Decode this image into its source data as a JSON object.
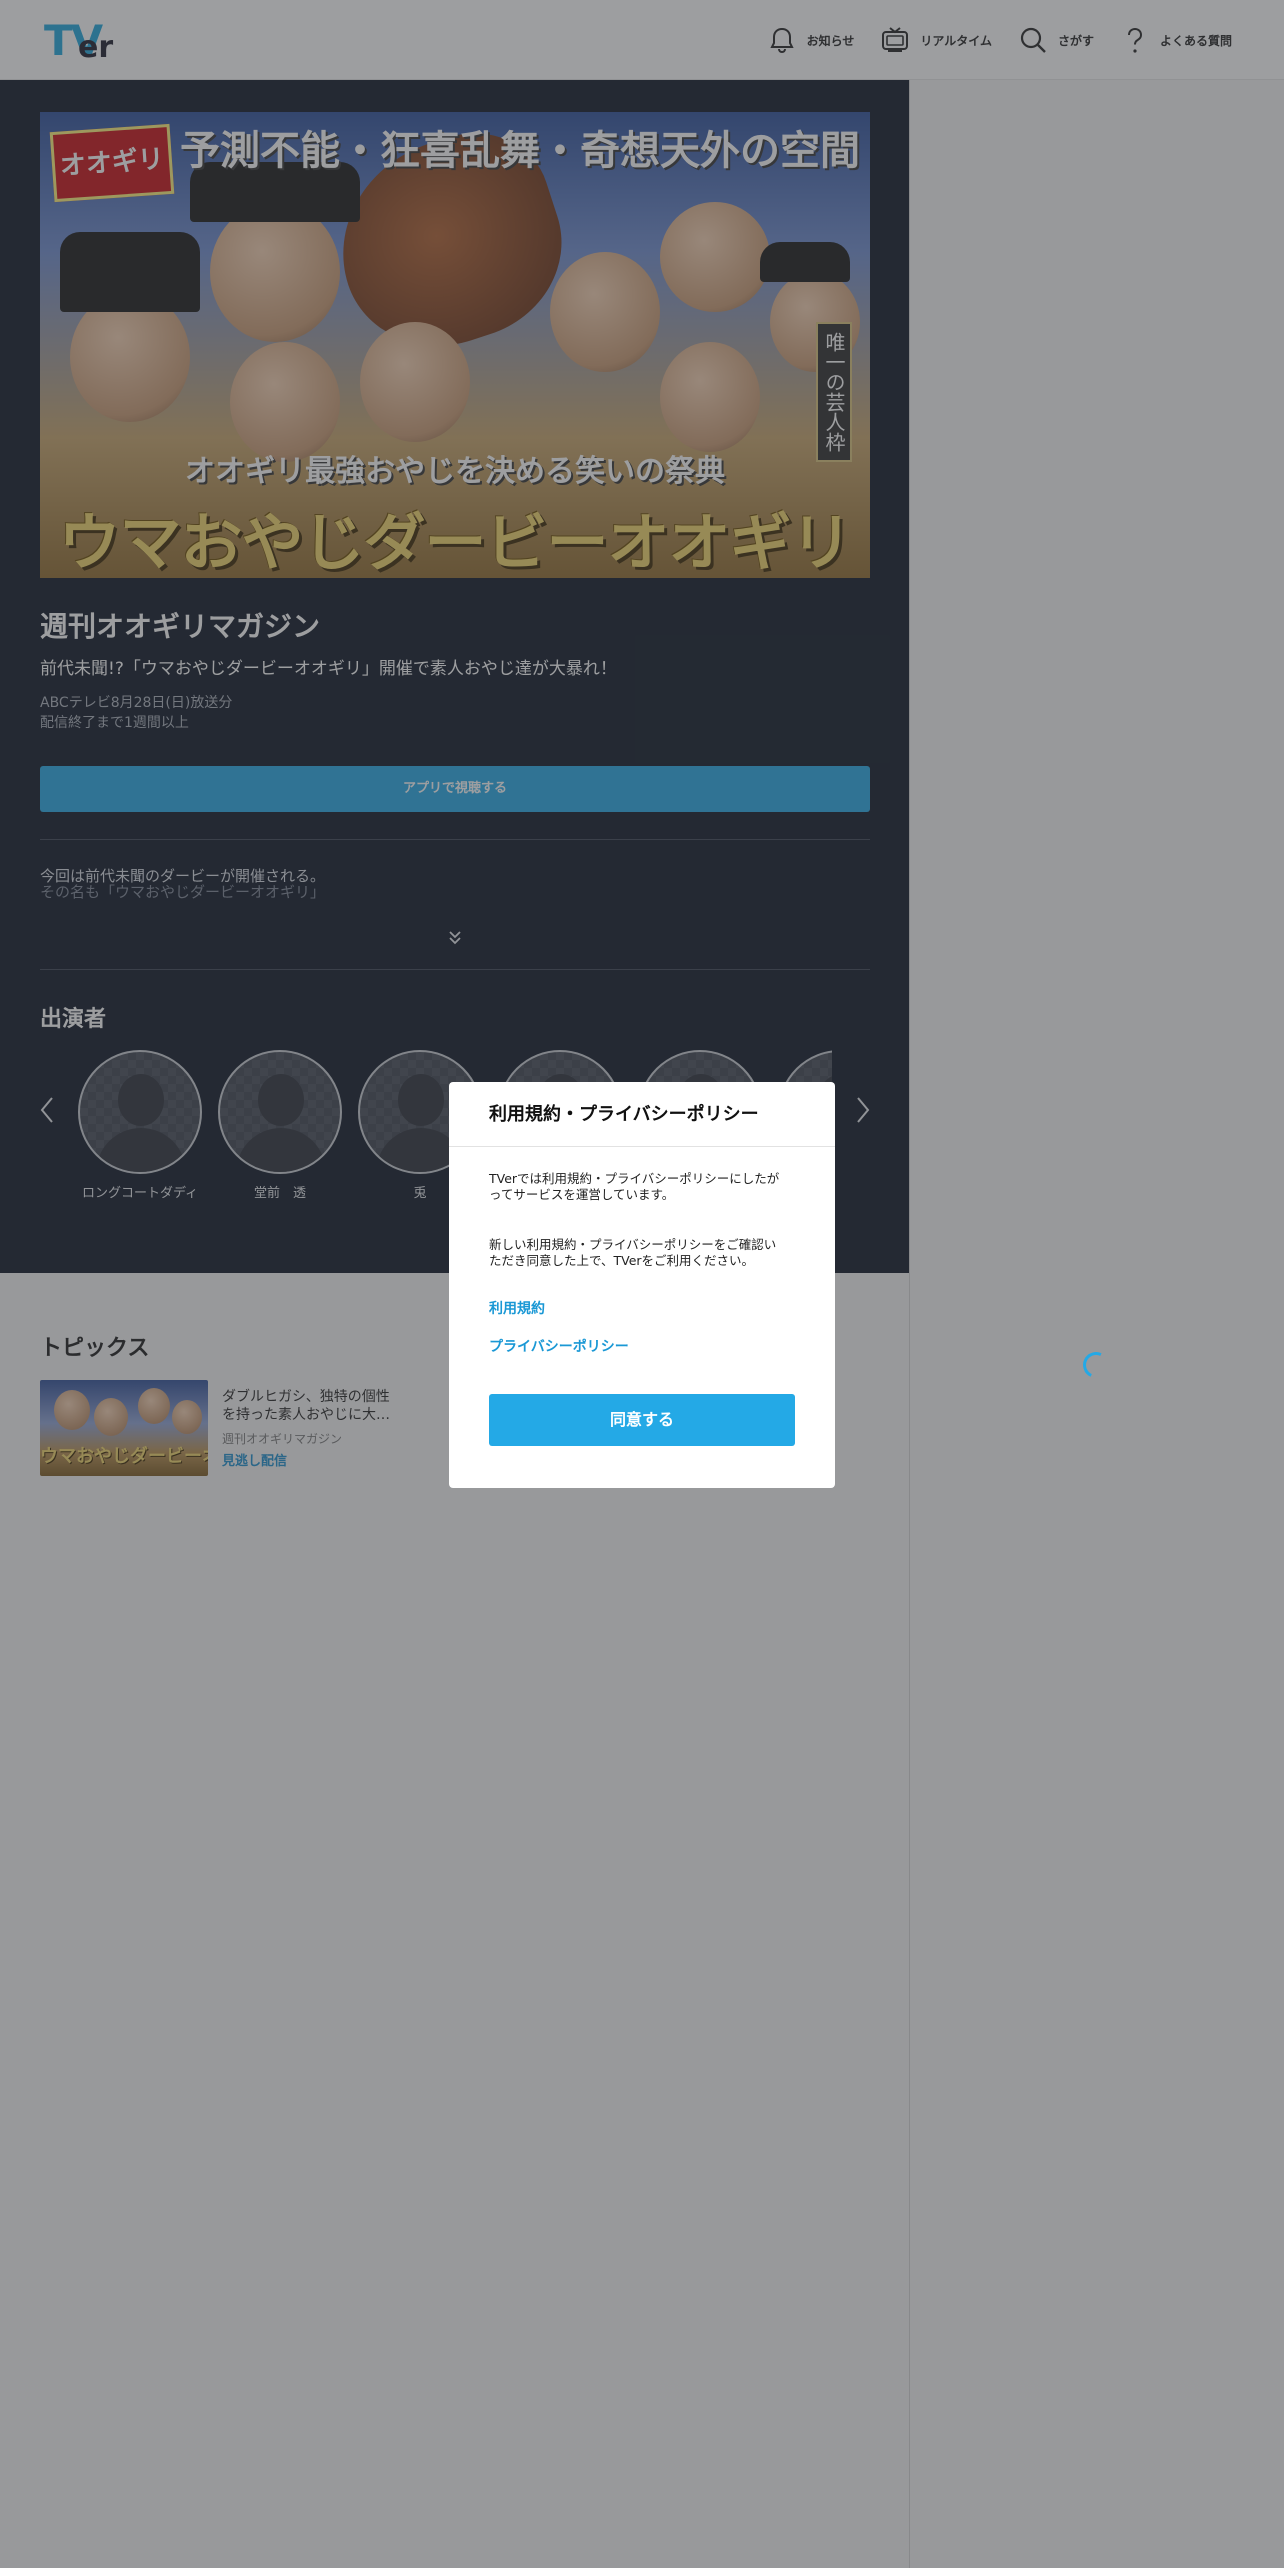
{
  "header": {
    "logo_main": "TV",
    "logo_sub": "er",
    "nav": [
      {
        "label": "お知らせ",
        "icon": "bell-icon"
      },
      {
        "label": "リアルタイム",
        "icon": "tv-icon"
      },
      {
        "label": "さがす",
        "icon": "search-icon"
      },
      {
        "label": "よくある質問",
        "icon": "question-icon"
      }
    ]
  },
  "hero": {
    "magazine_logo": "オオギリ",
    "top_caption": "予測不能・狂喜乱舞・奇想天外の空間",
    "vertical_caption": "唯一の芸人枠",
    "sub_caption": "オオギリ最強おやじを決める笑いの祭典",
    "big_title": "ウマおやじダービーオオギリ"
  },
  "program": {
    "series_title": "週刊オオギリマガジン",
    "episode_title": "前代未聞!?「ウマおやじダービーオオギリ」開催で素人おやじ達が大暴れ！",
    "broadcast_info": "ABCテレビ8月28日(日)放送分",
    "availability": "配信終了まで1週間以上",
    "watch_button": "アプリで視聴する",
    "description_line1": "今回は前代未聞のダービーが開催される。",
    "description_line2": "その名も「ウマおやじダービーオオギリ」"
  },
  "cast": {
    "heading": "出演者",
    "members": [
      {
        "name": "ロングコートダディ"
      },
      {
        "name": "堂前　透"
      },
      {
        "name": "兎"
      },
      {
        "name": ""
      },
      {
        "name": ""
      },
      {
        "name": ""
      }
    ]
  },
  "topics": {
    "heading": "トピックス",
    "items": [
      {
        "thumb_title": "ウマおやじダービーオオギリ",
        "text_line1": "ダブルヒガシ、独特の個性",
        "text_line2": "を持った素人おやじに大…",
        "series": "週刊オオギリマガジン",
        "badge": "見逃し配信"
      }
    ]
  },
  "modal": {
    "title": "利用規約・プライバシーポリシー",
    "paragraph1_line1": "TVerでは利用規約・プライバシーポリシーにしたが",
    "paragraph1_line2": "ってサービスを運営しています。",
    "paragraph2_line1": "新しい利用規約・プライバシーポリシーをご確認い",
    "paragraph2_line2": "ただき同意した上で、TVerをご利用ください。",
    "link_terms": "利用規約",
    "link_privacy": "プライバシーポリシー",
    "agree_button": "同意する"
  },
  "colors": {
    "accent": "#24a9e6",
    "program_background": "#0c1524",
    "overlay": "rgba(60,62,66,0.50)"
  }
}
